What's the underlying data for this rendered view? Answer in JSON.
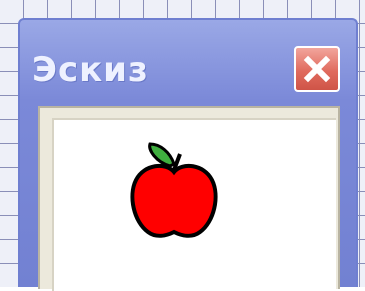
{
  "window": {
    "title": "Эскиз",
    "close_icon": "close-icon",
    "sketch_icon": "apple-icon"
  },
  "colors": {
    "titlebar": "#7b89d8",
    "close_button": "#e06b5e",
    "apple": "#ff0000",
    "leaf": "#3fae3f",
    "canvas": "#ffffff"
  }
}
